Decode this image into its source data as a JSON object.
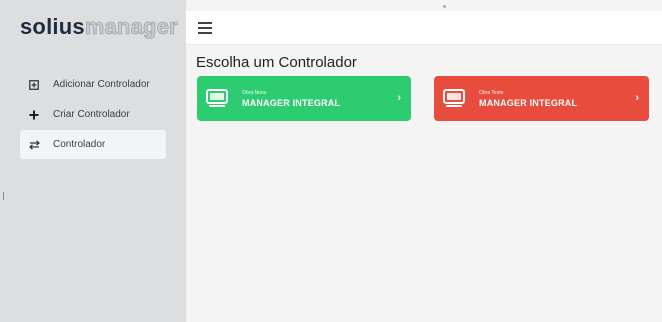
{
  "logo": {
    "bold": "solius",
    "light": "manager"
  },
  "sidebar": {
    "items": [
      {
        "icon": "plus-square-icon",
        "label": "Adicionar Controlador"
      },
      {
        "icon": "plus-icon",
        "label": "Criar Controlador"
      },
      {
        "icon": "transfer-icon",
        "label": "Controlador"
      }
    ]
  },
  "main": {
    "title": "Escolha um Controlador",
    "cards": [
      {
        "color": "#2ecc71",
        "small": "Obra Nova",
        "name": "MANAGER INTEGRAL"
      },
      {
        "color": "#e74c3c",
        "small": "Obra Teste",
        "name": "MANAGER INTEGRAL"
      }
    ]
  },
  "colors": {
    "sidebar_bg": "#dddee0",
    "content_bg": "#f4f4f4",
    "green": "#2ecc71",
    "red": "#e74c3c"
  }
}
